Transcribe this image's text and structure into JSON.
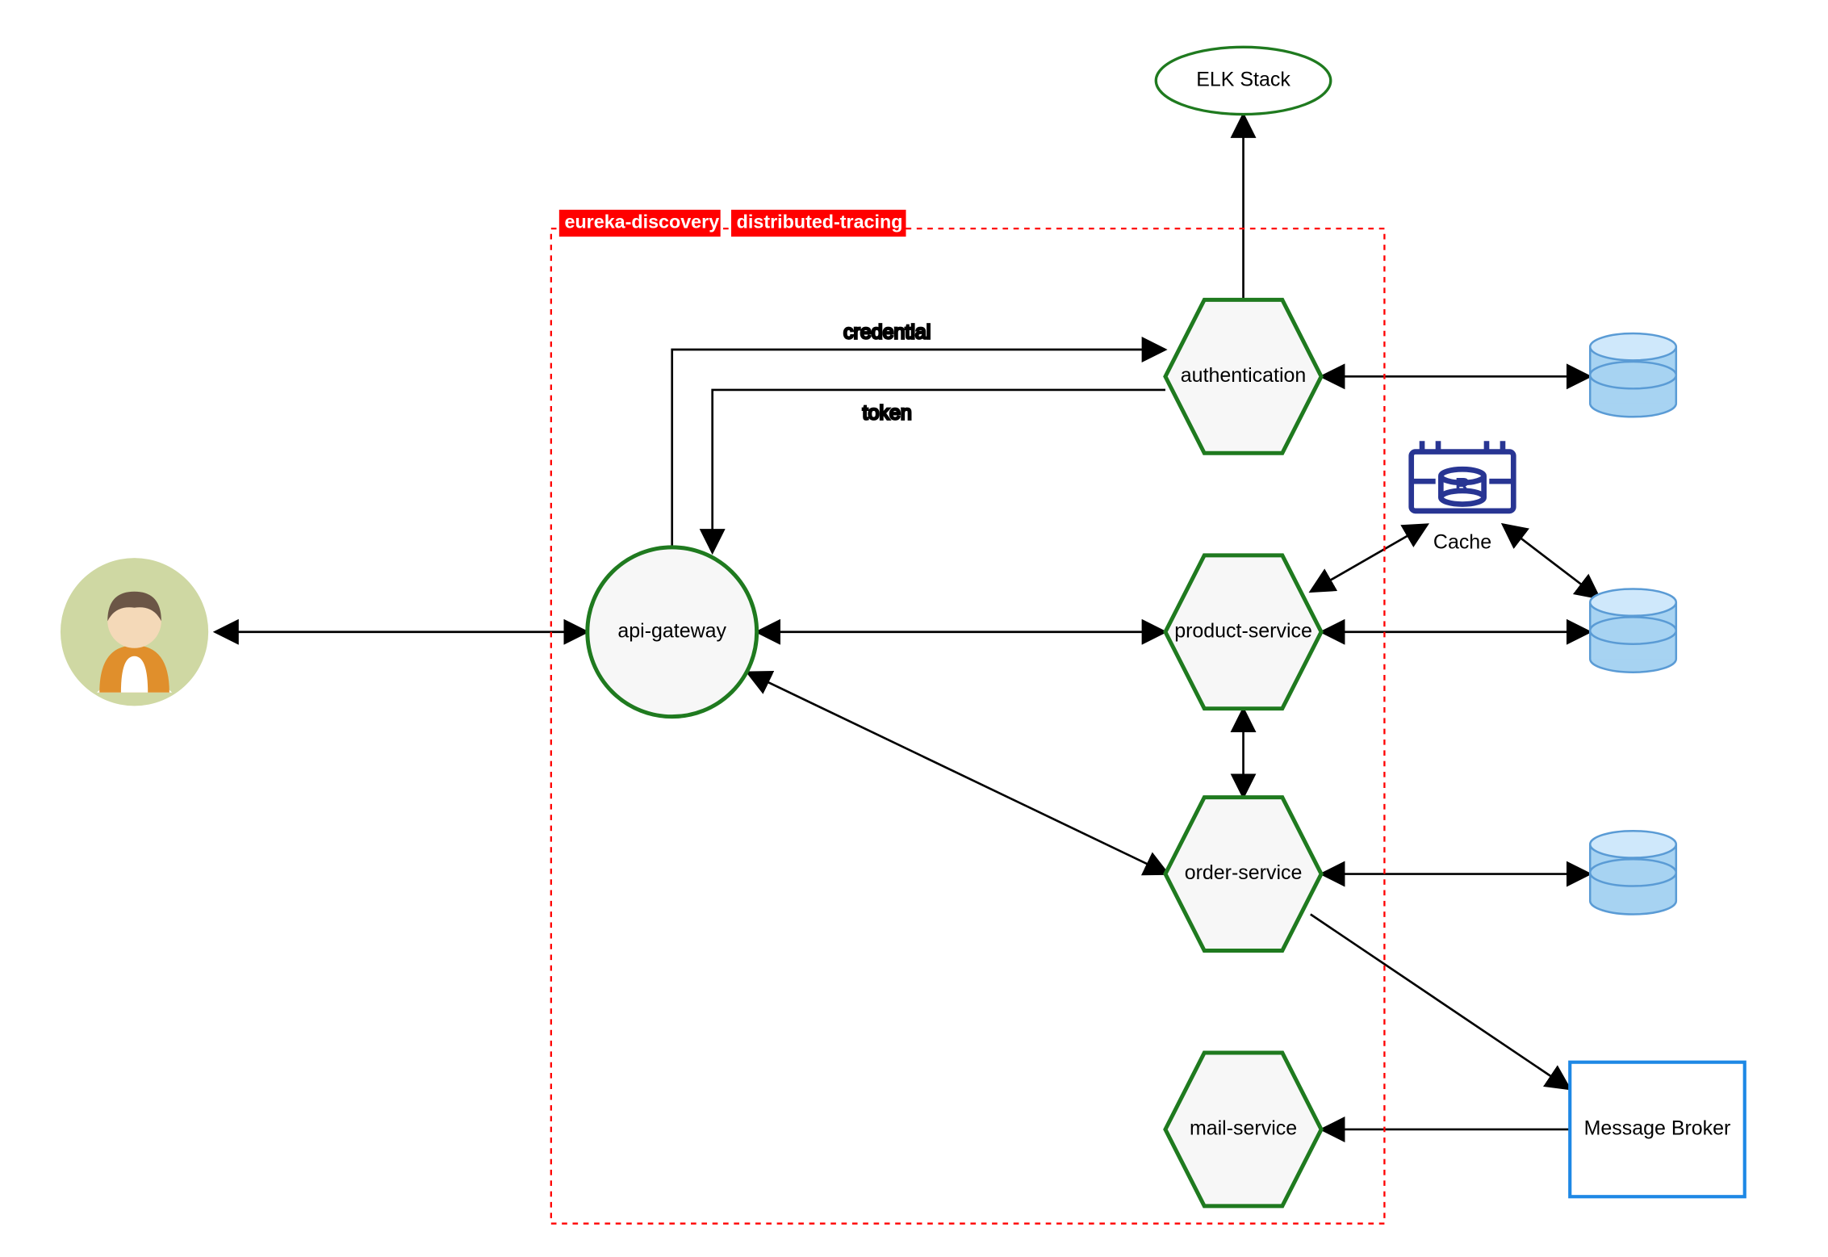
{
  "boundary": {
    "tags": [
      "eureka-discovery",
      "distributed-tracing"
    ]
  },
  "nodes": {
    "elk": {
      "label": "ELK Stack"
    },
    "gateway": {
      "label": "api-gateway"
    },
    "auth": {
      "label": "authentication"
    },
    "product": {
      "label": "product-service"
    },
    "order": {
      "label": "order-service"
    },
    "mail": {
      "label": "mail-service"
    },
    "cache": {
      "label": "Cache"
    },
    "broker": {
      "label": "Message Broker"
    }
  },
  "edges": {
    "credential": {
      "label": "credential"
    },
    "token": {
      "label": "token"
    }
  },
  "colors": {
    "green": "#1f7a1f",
    "red": "#ff0000",
    "blue": "#1e88e5",
    "indigo": "#283593",
    "dbFill": "#a7d3f2",
    "dbStroke": "#5a9bd5",
    "skin": "#f4d9b8",
    "hair": "#6b5646",
    "shirt": "#e08f2c",
    "avatarBg": "#cfd8a3"
  }
}
